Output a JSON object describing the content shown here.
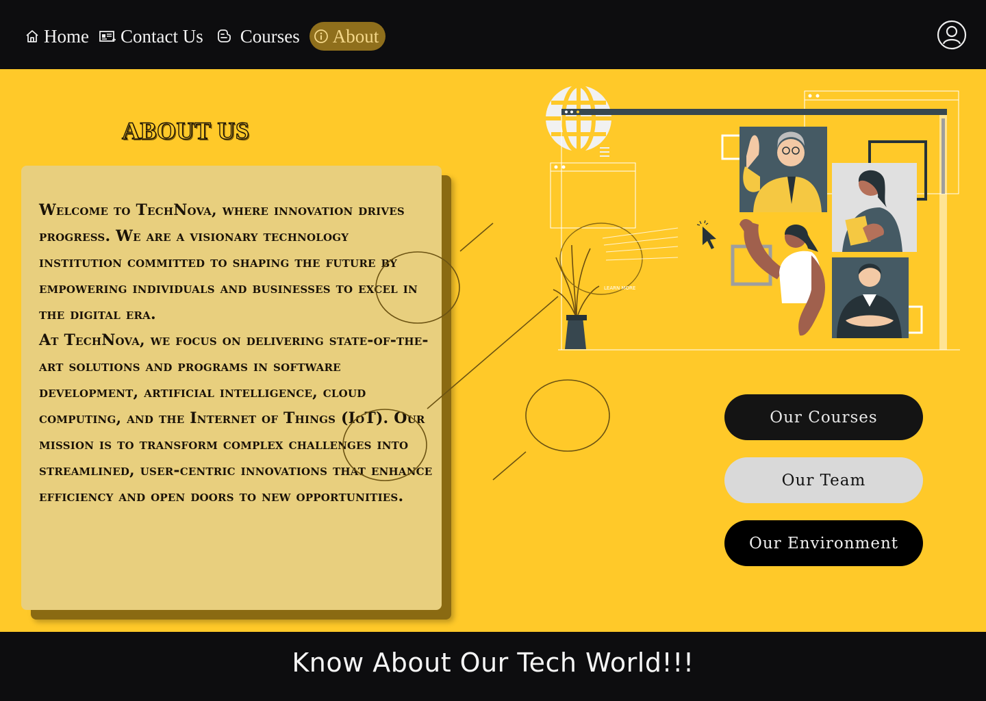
{
  "nav": {
    "items": [
      {
        "label": "Home",
        "icon": "home-icon"
      },
      {
        "label": "Contact Us",
        "icon": "contact-card-icon"
      },
      {
        "label": "Courses",
        "icon": "blog-icon"
      },
      {
        "label": "About",
        "icon": "info-icon",
        "active": true
      }
    ],
    "profile_icon": "user-profile-icon"
  },
  "about": {
    "title": "ABOUT US",
    "paragraphs": [
      "Welcome to TechNova, where innovation drives progress. We are a visionary technology institution committed to shaping the future by empowering individuals and businesses to excel in the digital era.",
      "At TechNova, we focus on delivering state-of-the-art solutions and programs in software development, artificial intelligence, cloud computing, and the Internet of Things (IoT). Our mission is to transform complex challenges into streamlined, user-centric innovations that enhance efficiency and open doors to new opportunities."
    ]
  },
  "illustration": {
    "learn_more": "LEARN MORE"
  },
  "buttons": {
    "courses": "Our Courses",
    "team": "Our Team",
    "environment": "Our Environment"
  },
  "footer": {
    "text": "Know About Our Tech World!!!"
  },
  "colors": {
    "page_bg": "#ffc929",
    "bar_bg": "#0d0d0f",
    "card_bg": "#e8cf7e",
    "active_nav": "#8f6f1c"
  }
}
